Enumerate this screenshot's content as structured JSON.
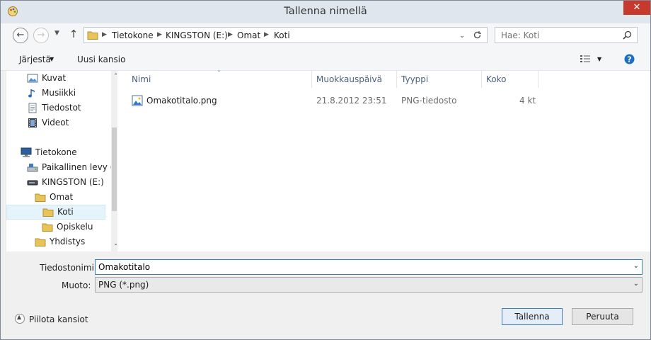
{
  "window": {
    "title": "Tallenna nimellä",
    "close_glyph": "✕"
  },
  "navigation": {
    "back_glyph": "←",
    "forward_glyph": "→",
    "up_glyph": "↑",
    "breadcrumb": [
      "Tietokone",
      "KINGSTON (E:)",
      "Omat",
      "Koti"
    ],
    "search_placeholder": "Hae: Koti"
  },
  "toolbar": {
    "organize_label": "Järjestä",
    "new_folder_label": "Uusi kansio"
  },
  "sidebar": {
    "items": [
      {
        "label": "Kuvat",
        "icon": "pictures-icon"
      },
      {
        "label": "Musiikki",
        "icon": "music-icon"
      },
      {
        "label": "Tiedostot",
        "icon": "documents-icon"
      },
      {
        "label": "Videot",
        "icon": "videos-icon"
      },
      {
        "label": "Tietokone",
        "icon": "computer-icon"
      },
      {
        "label": "Paikallinen levy (",
        "icon": "local-disk-icon"
      },
      {
        "label": "KINGSTON (E:)",
        "icon": "usb-drive-icon"
      },
      {
        "label": "Omat",
        "icon": "folder-icon"
      },
      {
        "label": "Koti",
        "icon": "folder-icon",
        "selected": true
      },
      {
        "label": "Opiskelu",
        "icon": "folder-icon"
      },
      {
        "label": "Yhdistys",
        "icon": "folder-icon"
      }
    ]
  },
  "files": {
    "columns": [
      "Nimi",
      "Muokkauspäivä",
      "Tyyppi",
      "Koko"
    ],
    "rows": [
      {
        "name": "Omakotitalo.png",
        "modified": "21.8.2012 23:51",
        "type": "PNG-tiedosto",
        "size": "4 kt"
      }
    ]
  },
  "form": {
    "filename_label": "Tiedostonimi:",
    "filename_value": "Omakotitalo",
    "type_label": "Muoto:",
    "type_value": "PNG (*.png)"
  },
  "actions": {
    "hide_folders_label": "Piilota kansiot",
    "save_label": "Tallenna",
    "cancel_label": "Peruuta"
  },
  "colors": {
    "accent": "#3c7fb1",
    "close": "#c7392c",
    "folder": "#e8c35a",
    "selection": "#e5f3fb"
  }
}
